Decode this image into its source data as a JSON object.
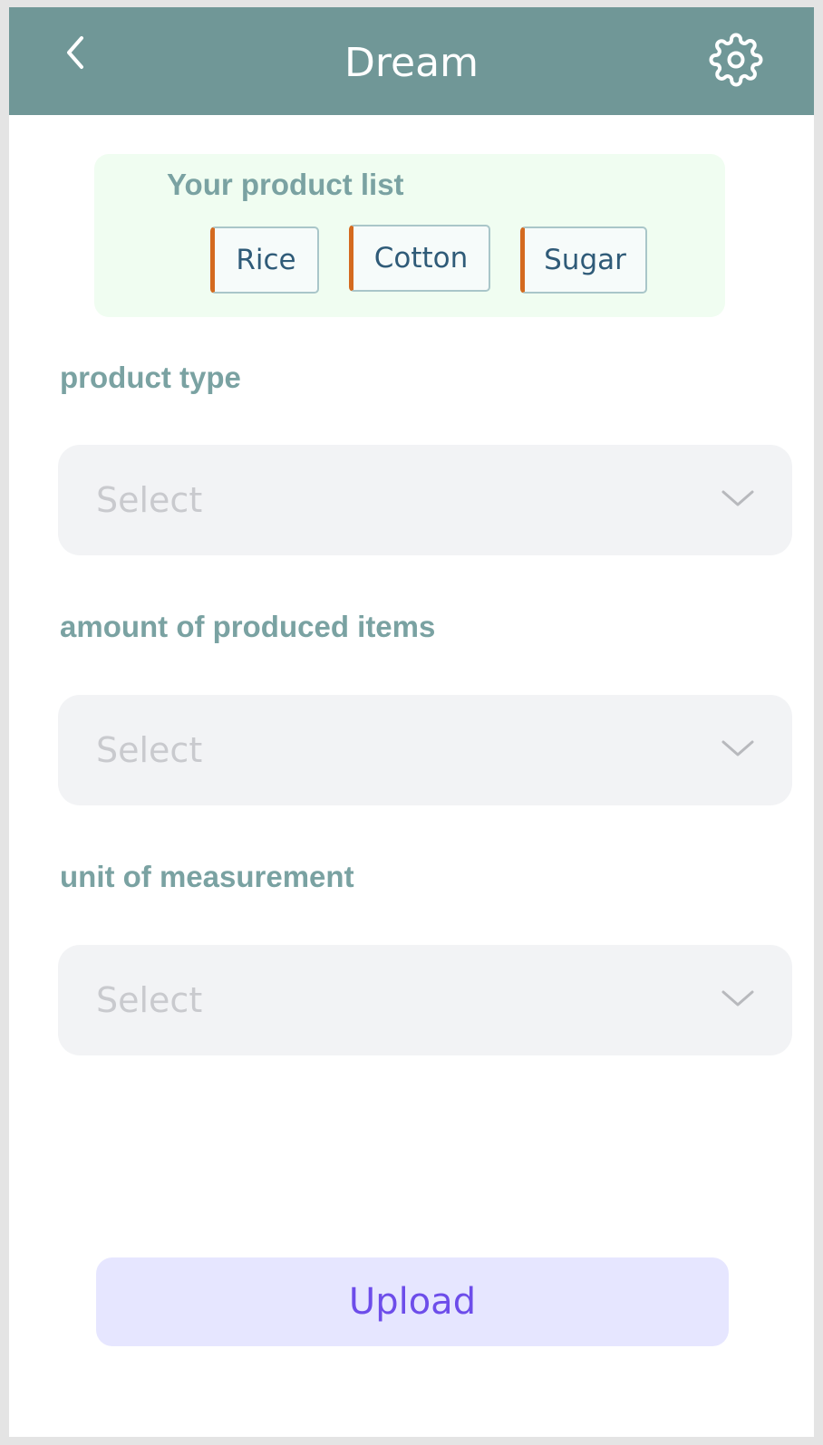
{
  "header": {
    "title": "Dream",
    "back_icon": "chevron-left-icon",
    "settings_icon": "gear-icon",
    "background_color": "#709797"
  },
  "product_list": {
    "title": "Your product list",
    "items": [
      "Rice",
      "Cotton",
      "Sugar"
    ],
    "accent_color": "#d46a1f"
  },
  "fields": [
    {
      "label": "product type",
      "placeholder": "Select"
    },
    {
      "label": "amount of produced items",
      "placeholder": "Select"
    },
    {
      "label": "unit of measurement",
      "placeholder": "Select"
    }
  ],
  "upload": {
    "label": "Upload",
    "text_color": "#6d4dea",
    "background_color": "#e6e6ff"
  }
}
